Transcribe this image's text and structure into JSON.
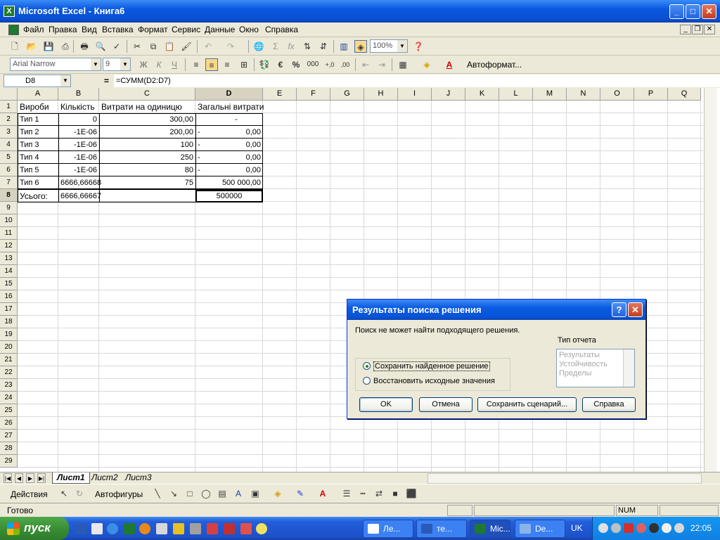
{
  "window": {
    "title": "Microsoft Excel - Книга6"
  },
  "menu": [
    "Файл",
    "Правка",
    "Вид",
    "Вставка",
    "Формат",
    "Сервис",
    "Данные",
    "Окно",
    "Справка"
  ],
  "toolbar": {
    "zoom": "100%",
    "font_name": "Arial Narrow",
    "font_size": "9",
    "autoformat_label": "Автоформат..."
  },
  "formula_bar": {
    "name_box": "D8",
    "equals": "=",
    "formula": "=СУММ(D2:D7)"
  },
  "columns": [
    "A",
    "B",
    "C",
    "D",
    "E",
    "F",
    "G",
    "H",
    "I",
    "J",
    "K",
    "L",
    "M",
    "N",
    "O",
    "P",
    "Q"
  ],
  "rows": [
    "1",
    "2",
    "3",
    "4",
    "5",
    "6",
    "7",
    "8",
    "9",
    "10",
    "11",
    "12",
    "13",
    "14",
    "15",
    "16",
    "17",
    "18",
    "19",
    "20",
    "21",
    "22",
    "23",
    "24",
    "25",
    "26",
    "27",
    "28",
    "29"
  ],
  "table": {
    "headers": [
      "Вироби",
      "Кількість",
      "Витрати на одиницю",
      "Загальні витрати"
    ],
    "rows": [
      [
        "Тип 1",
        "0",
        "300,00",
        "-"
      ],
      [
        "Тип 2",
        "-1E-06",
        "200,00",
        "0,00"
      ],
      [
        "Тип 3",
        "-1E-06",
        "100",
        "0,00"
      ],
      [
        "Тип 4",
        "-1E-06",
        "250",
        "0,00"
      ],
      [
        "Тип 5",
        "-1E-06",
        "80",
        "0,00"
      ],
      [
        "Тип 6",
        "6666,66668",
        "75",
        "500 000,00"
      ]
    ],
    "dash": "-",
    "total": {
      "label": "Усього:",
      "qty": "6666,66667",
      "cost": "",
      "sum": "500000"
    }
  },
  "sheets": [
    "Лист1",
    "Лист2",
    "Лист3"
  ],
  "drawing_toolbar": {
    "actions": "Действия",
    "autoshapes": "Автофигуры"
  },
  "status": {
    "text": "Готово",
    "num": "NUM"
  },
  "taskbar": {
    "start": "пуск",
    "tasks": [
      "Ле...",
      "те...",
      "Mic...",
      "De..."
    ],
    "lang": "UK",
    "clock": "22:05"
  },
  "dialog": {
    "title": "Результаты поиска решения",
    "help_icon": "?",
    "close_icon": "✕",
    "message": "Поиск не может найти подходящего решения.",
    "option_keep": "Сохранить найденное решение",
    "option_restore": "Восстановить исходные значения",
    "report_type_label": "Тип отчета",
    "report_items": [
      "Результаты",
      "Устойчивость",
      "Пределы"
    ],
    "buttons": {
      "ok": "OK",
      "cancel": "Отмена",
      "save_scenario": "Сохранить сценарий...",
      "help": "Справка"
    }
  }
}
